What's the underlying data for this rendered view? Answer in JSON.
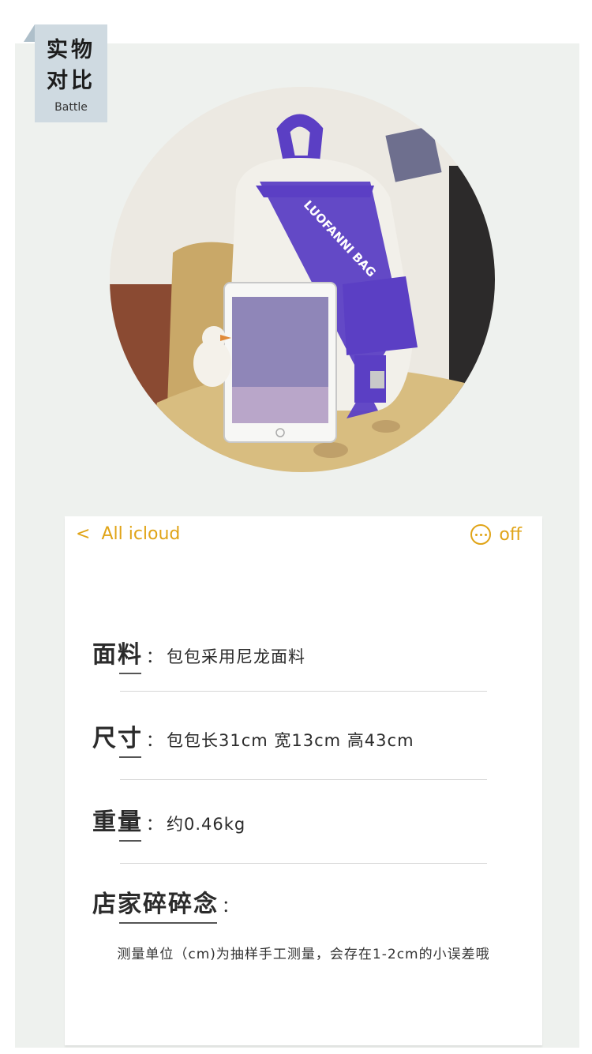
{
  "badge": {
    "line1": "实物",
    "line2": "对比",
    "line3": "Battle"
  },
  "photo": {
    "bag_print": "LUOFANNI BAG"
  },
  "nav": {
    "back_glyph": "<",
    "back_label": "All icloud",
    "right_label": "off"
  },
  "specs": [
    {
      "label": "面料",
      "sep": "：",
      "value": "包包采用尼龙面料"
    },
    {
      "label": "尺寸",
      "sep": "：",
      "value": "包包长31cm 宽13cm 高43cm"
    },
    {
      "label": "重量",
      "sep": "：",
      "value": "约0.46kg"
    },
    {
      "label": "店家碎碎念",
      "sep": "：",
      "value": ""
    }
  ],
  "note": "测量单位（cm)为抽样手工测量，会存在1-2cm的小误差哦",
  "colors": {
    "accent": "#e0a417",
    "badge_bg": "#cfdae1",
    "panel_bg": "#eef1ee",
    "bag_purple": "#5b3fc4"
  }
}
